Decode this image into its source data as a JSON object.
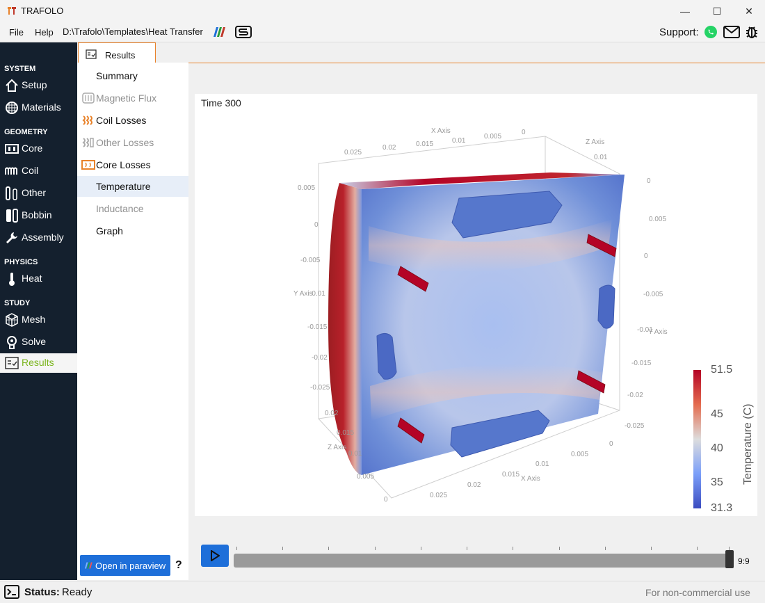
{
  "window": {
    "title": "TRAFOLO",
    "controls": {
      "minimize": "—",
      "maximize": "☐",
      "close": "✕"
    }
  },
  "menu": {
    "file": "File",
    "help": "Help",
    "path": "D:\\Trafolo\\Templates\\Heat Transfer"
  },
  "support": {
    "label": "Support:"
  },
  "sidebar": {
    "sections": {
      "system": "SYSTEM",
      "geometry": "GEOMETRY",
      "physics": "PHYSICS",
      "study": "STUDY"
    },
    "items": {
      "setup": "Setup",
      "materials": "Materials",
      "core": "Core",
      "coil": "Coil",
      "other": "Other",
      "bobbin": "Bobbin",
      "assembly": "Assembly",
      "heat": "Heat",
      "mesh": "Mesh",
      "solve": "Solve",
      "results": "Results"
    },
    "active": "results"
  },
  "results_tab": {
    "label": "Results"
  },
  "results_menu": {
    "summary": "Summary",
    "magnetic_flux": "Magnetic Flux",
    "coil_losses": "Coil Losses",
    "other_losses": "Other Losses",
    "core_losses": "Core Losses",
    "temperature": "Temperature",
    "inductance": "Inductance",
    "graph": "Graph",
    "selected": "temperature"
  },
  "open_paraview": {
    "label": "Open in paraview",
    "help": "?"
  },
  "viewer": {
    "time_label": "Time 300",
    "axes": {
      "x_axis_label": "X Axis",
      "y_axis_label": "Y Axis",
      "z_axis_label": "Z Axis",
      "top_x_ticks": [
        "0.025",
        "0.02",
        "0.015",
        "0.01",
        "0.005",
        "0"
      ],
      "top_z_ticks": [
        "0.01",
        "0"
      ],
      "left_y_ticks": [
        "0.005",
        "0",
        "-0.005",
        "-0.01",
        "-0.015",
        "-0.02",
        "-0.025"
      ],
      "left_z_ticks": [
        "0.02",
        "0.015",
        "0.01",
        "0.005",
        "0"
      ],
      "right_y_ticks": [
        "0.005",
        "0",
        "-0.005",
        "-0.01",
        "-0.015",
        "-0.02",
        "-0.025"
      ],
      "bottom_x_ticks": [
        "0.025",
        "0.02",
        "0.015",
        "0.01",
        "0.005",
        "0"
      ]
    },
    "colorbar": {
      "title": "Temperature (C)",
      "max": "51.5",
      "t1": "45",
      "t2": "40",
      "t3": "35",
      "min": "31.3",
      "colors": [
        "#b40426",
        "#e46c4f",
        "#dddddd",
        "#7b9ff9",
        "#3b4cc0"
      ]
    }
  },
  "animation": {
    "frame": "9:9",
    "progress": 1.0
  },
  "status": {
    "key": "Status:",
    "value": "Ready",
    "license": "For non-commercial use"
  },
  "accent": "#e8822a",
  "active_green": "#7ab51d",
  "button_blue": "#1e6fd9"
}
